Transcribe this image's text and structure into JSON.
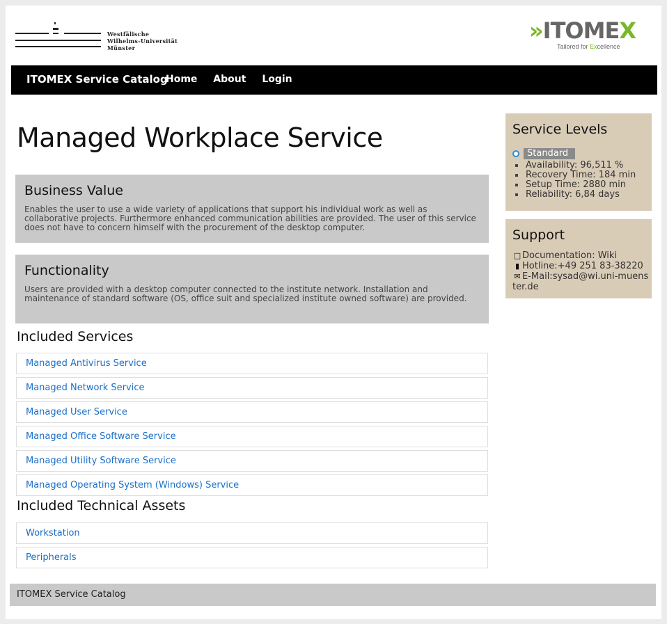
{
  "header": {
    "wwu_logo": {
      "lines": [
        "Westfälische",
        "Wilhelms-Universität",
        "Münster"
      ]
    },
    "itomex_logo": {
      "word_a": "»",
      "word_b": "ITOME",
      "word_c": "X",
      "tagline_a": "Tailored for ",
      "tagline_b": "Ex",
      "tagline_c": "cellence"
    }
  },
  "navbar": {
    "brand": "ITOMEX Service Catalog",
    "links": [
      "Home",
      "About",
      "Login"
    ]
  },
  "main": {
    "title": "Managed Workplace Service",
    "business_value": {
      "heading": "Business Value",
      "text": "Enables the user to use a wide variety of applications that support his individual work as well as collaborative projects. Furthermore enhanced communication abilities are provided. The user of this service does not have to concern himself with the procurement of the desktop computer."
    },
    "functionality": {
      "heading": "Functionality",
      "text": "Users are provided with a desktop computer connected to the institute network. Installation and maintenance of standard software (OS, office suit and specialized institute owned software) are provided."
    },
    "included_services": {
      "heading": "Included Services",
      "items": [
        "Managed Antivirus Service",
        "Managed Network Service",
        "Managed User Service",
        "Managed Office Software Service",
        "Managed Utility Software Service",
        "Managed Operating System (Windows) Service"
      ]
    },
    "included_assets": {
      "heading": "Included Technical Assets",
      "items": [
        "Workstation",
        "Peripherals"
      ]
    }
  },
  "sidebar": {
    "service_levels": {
      "heading": "Service Levels",
      "selected": "Standard",
      "items": [
        "Availability: 96,511 %",
        "Recovery Time: 184 min",
        "Setup Time: 2880 min",
        "Reliability: 6,84 days"
      ]
    },
    "support": {
      "heading": "Support",
      "documentation": "Documentation: Wiki",
      "hotline": "Hotline:+49 251 83-38220",
      "email": "E-Mail:sysad@wi.uni-muenster.de"
    }
  },
  "footer": {
    "text": "ITOMEX Service Catalog"
  },
  "colors": {
    "link": "#1a6fc9",
    "navbar": "#000000",
    "grey_box": "#c9c9c9",
    "sidebar_box": "#d9ccb7",
    "radio": "#2a8fd8",
    "brand_green": "#7ab829"
  },
  "icons": {
    "documentation": "document-icon",
    "hotline": "phone-icon",
    "email": "envelope-icon",
    "level_bullet": "square-bullet-icon",
    "level_radio": "radio-selected-icon"
  }
}
